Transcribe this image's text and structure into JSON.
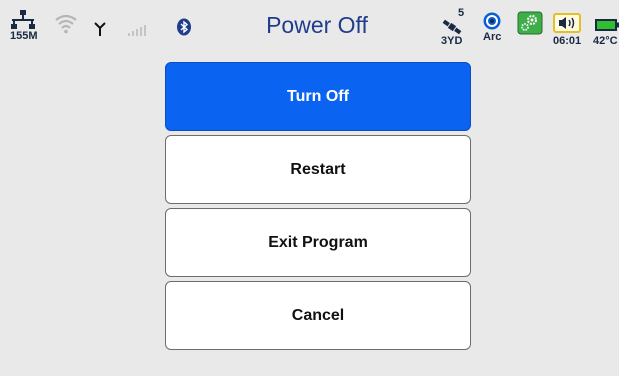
{
  "status": {
    "network_speed": "155M",
    "satellite_count": "5",
    "fix_mode": "3YD",
    "nav_mode": "Arc",
    "time": "06:01",
    "temperature": "42°C",
    "icons": [
      "ethernet-icon",
      "wifi-icon",
      "antenna-icon",
      "signal-bars-icon",
      "bluetooth-icon",
      "satellite-icon",
      "nav-mode-icon",
      "settings-gear-icon",
      "speaker-icon",
      "battery-icon"
    ],
    "colors": {
      "accent": "#0a63f1",
      "title": "#1f3d8a",
      "battery": "#2fbf2f",
      "gear_bg": "#3fae49"
    }
  },
  "title": "Power Off",
  "menu": {
    "selected_index": 0,
    "items": [
      {
        "label": "Turn Off"
      },
      {
        "label": "Restart"
      },
      {
        "label": "Exit Program"
      },
      {
        "label": "Cancel"
      }
    ]
  }
}
